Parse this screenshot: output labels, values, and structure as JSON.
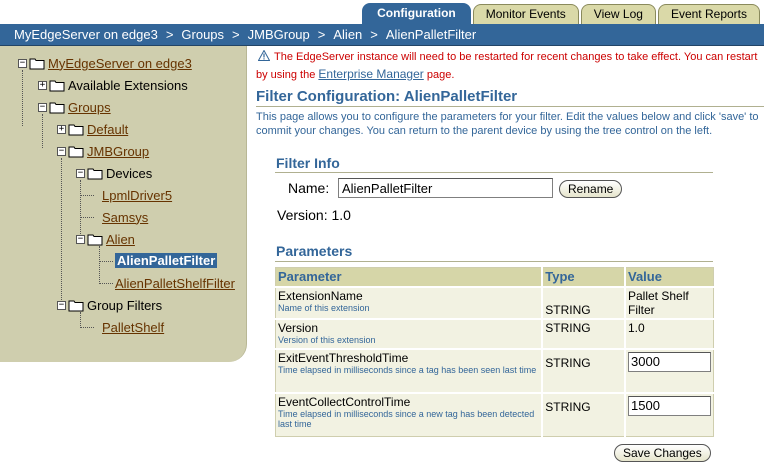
{
  "tabs": [
    {
      "label": "Configuration",
      "active": true
    },
    {
      "label": "Monitor Events",
      "active": false
    },
    {
      "label": "View Log",
      "active": false
    },
    {
      "label": "Event Reports",
      "active": false
    }
  ],
  "breadcrumb": [
    "MyEdgeServer on edge3",
    "Groups",
    "JMBGroup",
    "Alien",
    "AlienPalletFilter"
  ],
  "breadcrumb_separator": ">",
  "tree": {
    "root": "MyEdgeServer on edge3",
    "available_extensions": "Available Extensions",
    "groups": "Groups",
    "default": "Default",
    "jmbgroup": "JMBGroup",
    "devices": "Devices",
    "lpml": "LpmlDriver5",
    "samsys": "Samsys",
    "alien": "Alien",
    "alien_pallet_filter": "AlienPalletFilter",
    "alien_pallet_shelf_filter": "AlienPalletShelfFilter",
    "group_filters": "Group Filters",
    "pallet_shelf": "PalletShelf",
    "expanded_mark": "−",
    "collapsed_mark": "+"
  },
  "warning": {
    "line1": "The EdgeServer instance will need to be restarted for recent changes to take effect. You can restart",
    "line2_before": "by using the",
    "link": "Enterprise Manager",
    "line2_after": "page."
  },
  "page": {
    "title": "Filter Configuration: AlienPalletFilter",
    "description": "This page allows you to configure the parameters for your filter. Edit the values below and click 'save' to commit your changes. You can return to the parent device by using the tree control on the left."
  },
  "filter_info": {
    "heading": "Filter Info",
    "name_label": "Name:",
    "name_value": "AlienPalletFilter",
    "rename_label": "Rename",
    "version_text": "Version: 1.0"
  },
  "parameters": {
    "heading": "Parameters",
    "columns": [
      "Parameter",
      "Type",
      "Value"
    ],
    "rows": [
      {
        "name": "ExtensionName",
        "desc": "Name of this extension",
        "type": "STRING",
        "value": "Pallet Shelf Filter",
        "editable": false
      },
      {
        "name": "Version",
        "desc": "Version of this extension",
        "type": "STRING",
        "value": "1.0",
        "editable": false
      },
      {
        "name": "ExitEventThresholdTime",
        "desc": "Time elapsed in milliseconds since a tag has been seen last time",
        "type": "STRING",
        "value": "3000",
        "editable": true
      },
      {
        "name": "EventCollectControlTime",
        "desc": "Time elapsed in milliseconds since a new tag has been detected last time",
        "type": "STRING",
        "value": "1500",
        "editable": true
      }
    ]
  },
  "save_label": "Save Changes",
  "colors": {
    "accent": "#336699",
    "tree_bg": "#cfceae",
    "warning": "#cc0000",
    "table_header": "#d6d6a8"
  }
}
